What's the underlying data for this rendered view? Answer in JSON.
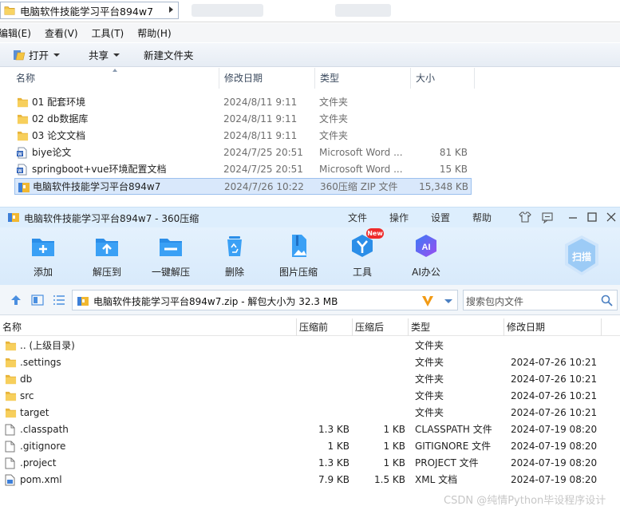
{
  "explorer": {
    "address": "电脑软件技能学习平台894w7",
    "menu": [
      "编辑(E)",
      "查看(V)",
      "工具(T)",
      "帮助(H)"
    ],
    "toolbar": {
      "open": "打开",
      "share": "共享",
      "new_folder": "新建文件夹"
    },
    "columns": {
      "name": "名称",
      "modified": "修改日期",
      "type": "类型",
      "size": "大小"
    },
    "rows": [
      {
        "name": "01 配套环境",
        "modified": "2024/8/11 9:11",
        "type": "文件夹",
        "size": "",
        "icon": "folder-icon"
      },
      {
        "name": "02 db数据库",
        "modified": "2024/8/11 9:11",
        "type": "文件夹",
        "size": "",
        "icon": "folder-icon"
      },
      {
        "name": "03 论文文档",
        "modified": "2024/8/11 9:11",
        "type": "文件夹",
        "size": "",
        "icon": "folder-icon"
      },
      {
        "name": "biye论文",
        "modified": "2024/7/25 20:51",
        "type": "Microsoft Word ...",
        "size": "81 KB",
        "icon": "word-icon"
      },
      {
        "name": "springboot+vue环境配置文档",
        "modified": "2024/7/25 20:51",
        "type": "Microsoft Word ...",
        "size": "15 KB",
        "icon": "word-icon"
      },
      {
        "name": "电脑软件技能学习平台894w7",
        "modified": "2024/7/26 10:22",
        "type": "360压缩 ZIP 文件",
        "size": "15,348 KB",
        "icon": "zip-icon"
      }
    ]
  },
  "zip": {
    "title": "电脑软件技能学习平台894w7 - 360压缩",
    "menu": [
      "文件",
      "操作",
      "设置",
      "帮助"
    ],
    "toolbar": [
      "添加",
      "解压到",
      "一键解压",
      "删除",
      "图片压缩",
      "工具",
      "AI办公"
    ],
    "new_badge": "New",
    "scan_label": "扫描",
    "ai_glyph": "AI",
    "path_text": "电脑软件技能学习平台894w7.zip - 解包大小为 32.3 MB",
    "search_placeholder": "搜索包内文件",
    "columns": {
      "name": "名称",
      "before": "压缩前",
      "after": "压缩后",
      "type": "类型",
      "modified": "修改日期"
    },
    "rows": [
      {
        "name": ".. (上级目录)",
        "before": "",
        "after": "",
        "type": "文件夹",
        "modified": "",
        "icon": "folder-icon"
      },
      {
        "name": ".settings",
        "before": "",
        "after": "",
        "type": "文件夹",
        "modified": "2024-07-26 10:21",
        "icon": "folder-icon"
      },
      {
        "name": "db",
        "before": "",
        "after": "",
        "type": "文件夹",
        "modified": "2024-07-26 10:21",
        "icon": "folder-icon"
      },
      {
        "name": "src",
        "before": "",
        "after": "",
        "type": "文件夹",
        "modified": "2024-07-26 10:21",
        "icon": "folder-icon"
      },
      {
        "name": "target",
        "before": "",
        "after": "",
        "type": "文件夹",
        "modified": "2024-07-26 10:21",
        "icon": "folder-icon"
      },
      {
        "name": ".classpath",
        "before": "1.3 KB",
        "after": "1 KB",
        "type": "CLASSPATH 文件",
        "modified": "2024-07-19 08:20",
        "icon": "file-icon"
      },
      {
        "name": ".gitignore",
        "before": "1 KB",
        "after": "1 KB",
        "type": "GITIGNORE 文件",
        "modified": "2024-07-19 08:20",
        "icon": "file-icon"
      },
      {
        "name": ".project",
        "before": "1.3 KB",
        "after": "1 KB",
        "type": "PROJECT 文件",
        "modified": "2024-07-19 08:20",
        "icon": "file-icon"
      },
      {
        "name": "pom.xml",
        "before": "7.9 KB",
        "after": "1.5 KB",
        "type": "XML 文档",
        "modified": "2024-07-19 08:20",
        "icon": "xml-file-icon"
      }
    ]
  },
  "watermark": "CSDN @纯情Python毕设程序设计"
}
